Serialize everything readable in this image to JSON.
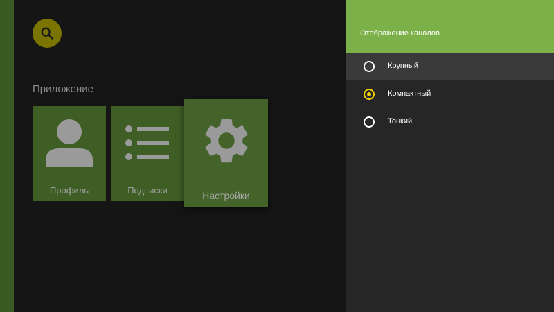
{
  "search": {
    "icon": "search-icon",
    "color": "#7a7400"
  },
  "section": {
    "title": "Приложение"
  },
  "cards": [
    {
      "label": "Профиль",
      "icon": "person-icon"
    },
    {
      "label": "Подписки",
      "icon": "list-icon"
    },
    {
      "label": "Настройки",
      "icon": "gear-icon"
    }
  ],
  "panel": {
    "title": "Отображение каналов",
    "accent": "#7cb048",
    "options": [
      {
        "label": "Крупный",
        "selected": false,
        "focused": true
      },
      {
        "label": "Компактный",
        "selected": true,
        "focused": false
      },
      {
        "label": "Тонкий",
        "selected": false,
        "focused": false
      }
    ]
  }
}
